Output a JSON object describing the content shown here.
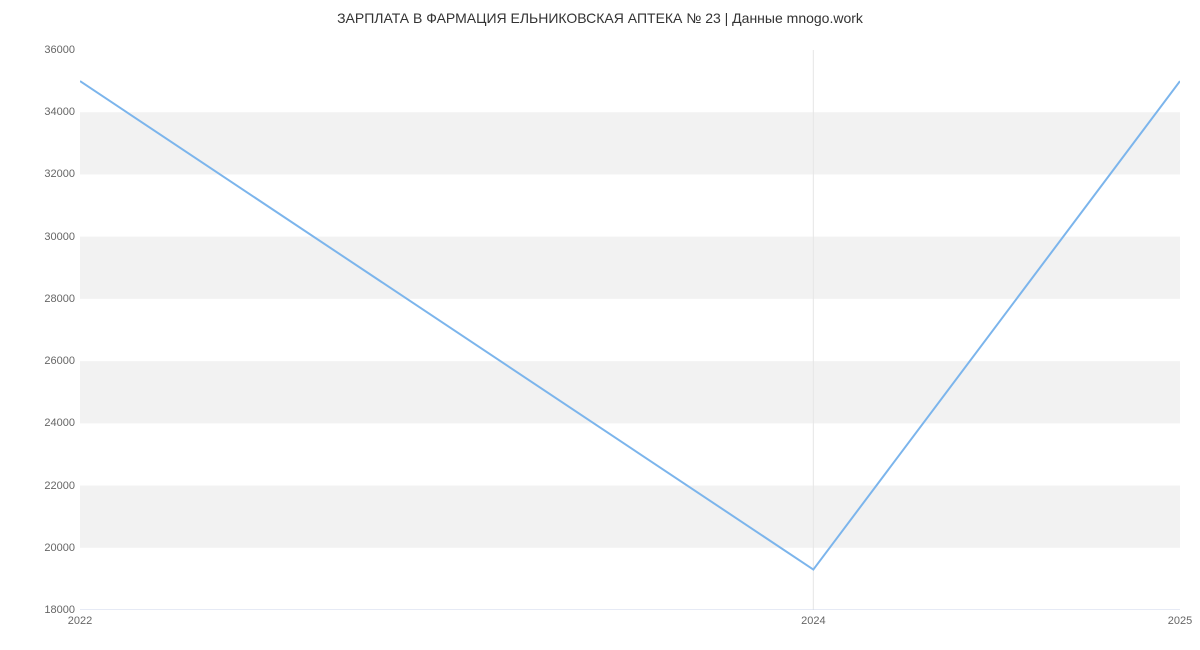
{
  "chart_data": {
    "type": "line",
    "title": "ЗАРПЛАТА В ФАРМАЦИЯ ЕЛЬНИКОВСКАЯ АПТЕКА № 23 | Данные mnogo.work",
    "xlabel": "",
    "ylabel": "",
    "x": [
      2022,
      2024,
      2025
    ],
    "values": [
      35000,
      19300,
      35000
    ],
    "y_ticks": [
      18000,
      20000,
      22000,
      24000,
      26000,
      28000,
      30000,
      32000,
      34000,
      36000
    ],
    "x_ticks": [
      2022,
      2024,
      2025
    ],
    "ylim": [
      18000,
      36000
    ],
    "xlim": [
      2022,
      2025
    ],
    "colors": {
      "line": "#7cb5ec",
      "band": "#f2f2f2"
    }
  }
}
